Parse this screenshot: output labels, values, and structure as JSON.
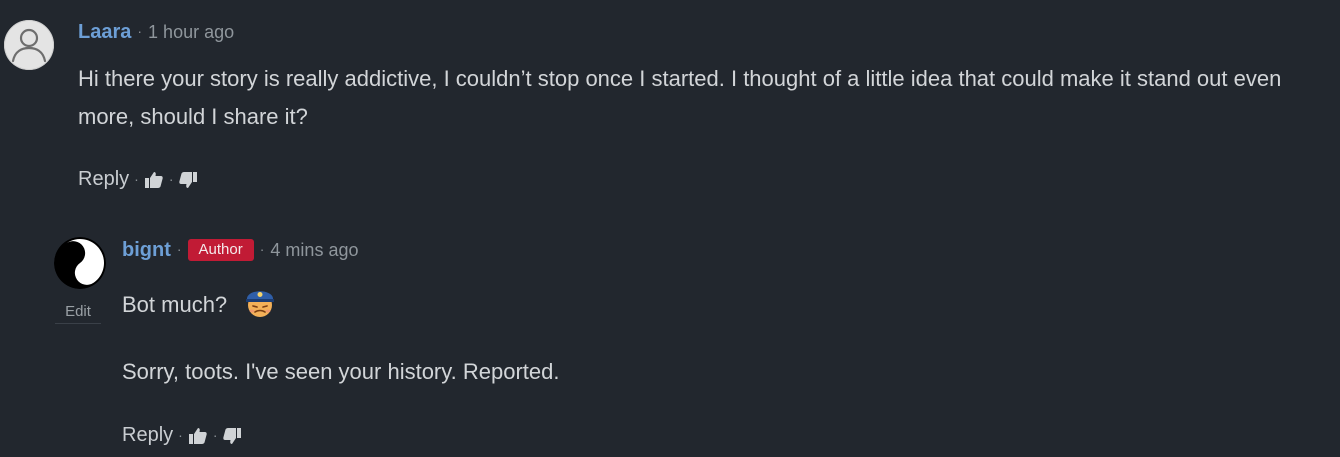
{
  "comments": [
    {
      "username": "Laara",
      "time": "1 hour ago",
      "body": "Hi there your story is really addictive, I couldn’t stop once I started. I thought of a little idea that could make it stand out even more, should I share it?",
      "reply_label": "Reply"
    },
    {
      "username": "bignt",
      "badge": "Author",
      "time": "4 mins ago",
      "line1": "Bot much?",
      "line2": "Sorry, toots. I've seen your history. Reported.",
      "edit_label": "Edit",
      "reply_label": "Reply"
    }
  ],
  "separator": "·",
  "icons": {
    "default_avatar": "user-silhouette-icon",
    "author_avatar": "yin-yang-icon",
    "emoji": "police-officer-emoji-icon",
    "like": "thumbs-up-icon",
    "dislike": "thumbs-down-icon"
  },
  "colors": {
    "background": "#22272e",
    "username": "#6d9fd6",
    "badge": "#c11b35"
  }
}
